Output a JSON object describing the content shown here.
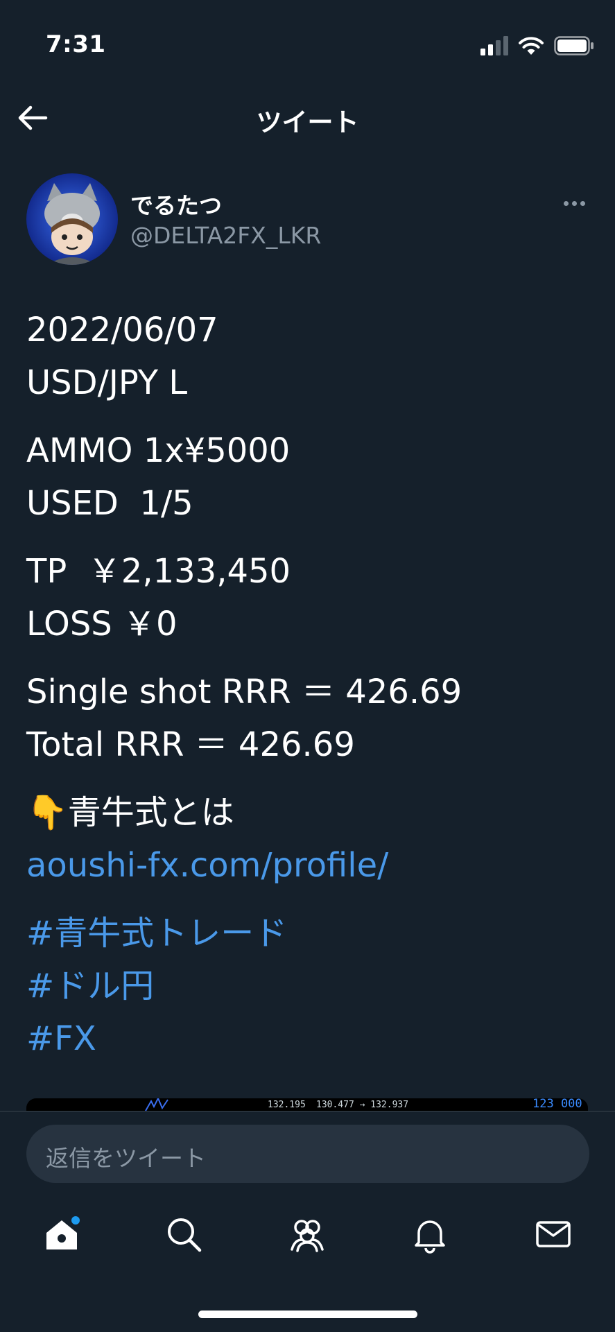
{
  "status_bar": {
    "time": "7:31"
  },
  "header": {
    "title": "ツイート"
  },
  "author": {
    "display_name": "でるたつ",
    "handle": "@DELTA2FX_LKR"
  },
  "tweet": {
    "paragraphs": [
      [
        "2022/06/07",
        "USD/JPY L"
      ],
      [
        "AMMO 1x¥5000",
        "USED  1/5"
      ],
      [
        "TP  ￥2,133,450",
        "LOSS ￥0"
      ],
      [
        "Single shot RRR ＝ 426.69",
        "Total RRR ＝ 426.69"
      ],
      [
        "👇青牛式とは"
      ]
    ],
    "link": "aoushi-fx.com/profile/",
    "hashtags": [
      "#青牛式トレード",
      "#ドル円",
      "#FX"
    ]
  },
  "preview": {
    "tick_1": "132.195",
    "tick_2": "130.477 → 132.937",
    "tick_3": "123 000"
  },
  "reply": {
    "placeholder": "返信をツイート"
  },
  "tabs": [
    "home-icon",
    "search-icon",
    "communities-icon",
    "notifications-icon",
    "messages-icon"
  ],
  "colors": {
    "background": "#15202b",
    "accent": "#4a99e9",
    "muted": "#8b98a5"
  }
}
